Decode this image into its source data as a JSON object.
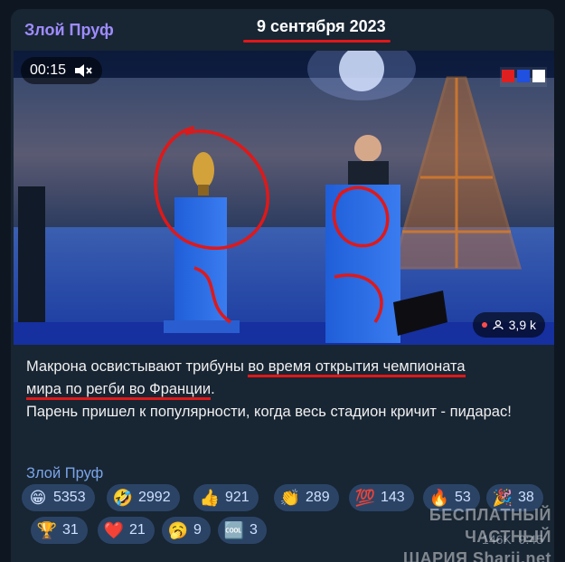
{
  "post": {
    "channel_name": "Злой Пруф",
    "date": "9 сентября 2023",
    "video": {
      "time": "00:15",
      "mute_icon": "speaker-muted-icon",
      "channel_logo": "TF1",
      "views": "3,9 k"
    },
    "text": {
      "part1": "Макрона освистывают трибуны ",
      "part2": "во время открытия чемпионата",
      "part3": "мира по регби во Франции",
      "part4": ".",
      "line2": "Парень пришел к популярности, когда весь стадион кричит - пидарас!"
    },
    "signature": "Злой Пруф",
    "reactions": [
      {
        "emoji": "😁",
        "count": "5353"
      },
      {
        "emoji": "🤣",
        "count": "2992"
      },
      {
        "emoji": "👍",
        "count": "921"
      },
      {
        "emoji": "👏",
        "count": "289"
      },
      {
        "emoji": "💯",
        "count": "143"
      },
      {
        "emoji": "🔥",
        "count": "53"
      },
      {
        "emoji": "🎉",
        "count": "38"
      },
      {
        "emoji": "🏆",
        "count": "31"
      },
      {
        "emoji": "❤️",
        "count": "21"
      },
      {
        "emoji": "🥱",
        "count": "9"
      },
      {
        "emoji": "🆒",
        "count": "3"
      }
    ],
    "watermark_line1": "БЕСПЛАТНЫЙ ЧАСТНЫЙ",
    "watermark_line2": "ШАРИЯ  Sharij.net",
    "views": "146K",
    "time": "9:45"
  }
}
